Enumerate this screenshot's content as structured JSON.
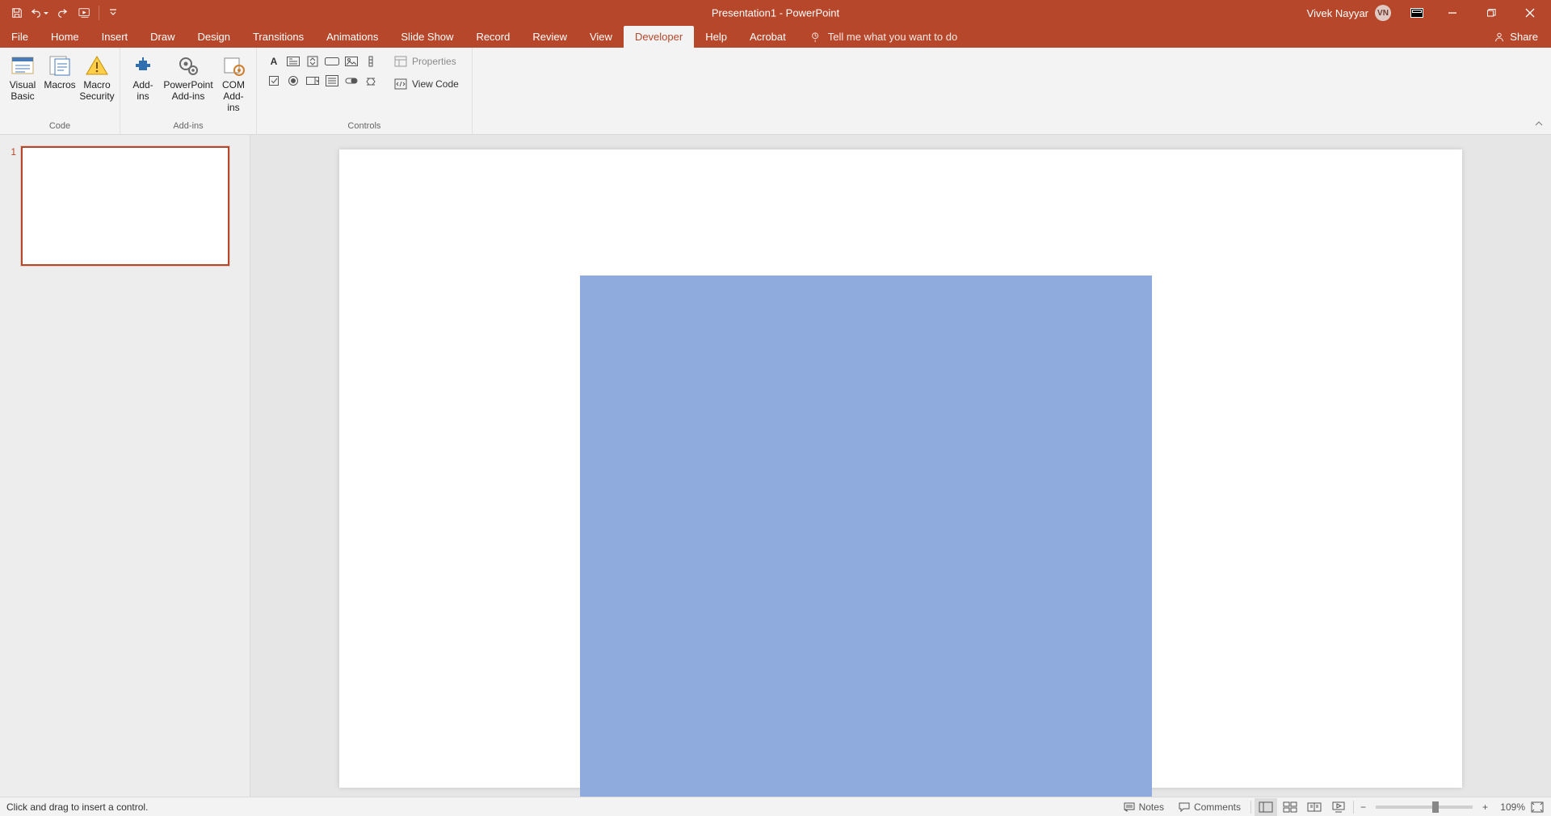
{
  "title": {
    "doc": "Presentation1",
    "sep": "  -  ",
    "app": "PowerPoint"
  },
  "user": {
    "name": "Vivek Nayyar",
    "initials": "VN"
  },
  "tabs": {
    "file": "File",
    "home": "Home",
    "insert": "Insert",
    "draw": "Draw",
    "design": "Design",
    "transitions": "Transitions",
    "animations": "Animations",
    "slideshow": "Slide Show",
    "record": "Record",
    "review": "Review",
    "view": "View",
    "developer": "Developer",
    "help": "Help",
    "acrobat": "Acrobat"
  },
  "tellme": "Tell me what you want to do",
  "share": "Share",
  "ribbon": {
    "code": {
      "group": "Code",
      "visual_basic": {
        "l1": "Visual",
        "l2": "Basic"
      },
      "macros": {
        "l1": "Macros"
      },
      "macro_security": {
        "l1": "Macro",
        "l2": "Security"
      }
    },
    "addins": {
      "group": "Add-ins",
      "addins": {
        "l1": "Add-",
        "l2": "ins"
      },
      "pp_addins": {
        "l1": "PowerPoint",
        "l2": "Add-ins"
      },
      "com_addins": {
        "l1": "COM",
        "l2": "Add-ins"
      }
    },
    "controls": {
      "group": "Controls",
      "properties": "Properties",
      "view_code": "View Code"
    }
  },
  "slides": {
    "first_num": "1"
  },
  "status": {
    "msg": "Click and drag to insert a control.",
    "notes": "Notes",
    "comments": "Comments",
    "zoom": "109%"
  }
}
